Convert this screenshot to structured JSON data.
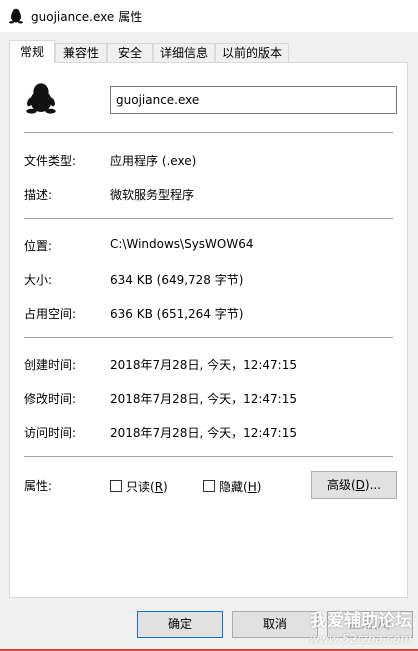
{
  "window": {
    "title": "guojiance.exe",
    "title_suffix": "属性"
  },
  "tabs": [
    {
      "label": "常规",
      "active": true
    },
    {
      "label": "兼容性",
      "active": false
    },
    {
      "label": "安全",
      "active": false
    },
    {
      "label": "详细信息",
      "active": false
    },
    {
      "label": "以前的版本",
      "active": false
    }
  ],
  "general": {
    "filename": "guojiance.exe",
    "file_type_label": "文件类型:",
    "file_type_value": "应用程序 (.exe)",
    "description_label": "描述:",
    "description_value": "微软服务型程序",
    "location_label": "位置:",
    "location_value": "C:\\Windows\\SysWOW64",
    "size_label": "大小:",
    "size_value": "634 KB (649,728 字节)",
    "size_on_disk_label": "占用空间:",
    "size_on_disk_value": "636 KB (651,264 字节)",
    "created_label": "创建时间:",
    "created_value": "2018年7月28日, 今天，12:47:15",
    "modified_label": "修改时间:",
    "modified_value": "2018年7月28日, 今天，12:47:15",
    "accessed_label": "访问时间:",
    "accessed_value": "2018年7月28日, 今天，12:47:15",
    "attributes_label": "属性:",
    "readonly_label": "只读(",
    "readonly_key": "R",
    "readonly_end": ")",
    "readonly_checked": false,
    "hidden_label": "隐藏(",
    "hidden_key": "H",
    "hidden_end": ")",
    "hidden_checked": false,
    "advanced_label": "高级(",
    "advanced_key": "D",
    "advanced_end": ")..."
  },
  "buttons": {
    "ok": "确定",
    "cancel": "取消",
    "apply": "应用(A)"
  },
  "watermark": {
    "line1": "我爱辅助论坛",
    "line2": "www.52fzba.com"
  },
  "colors": {
    "accent": "#0078d7",
    "watermark_strip": "#c8443a"
  }
}
